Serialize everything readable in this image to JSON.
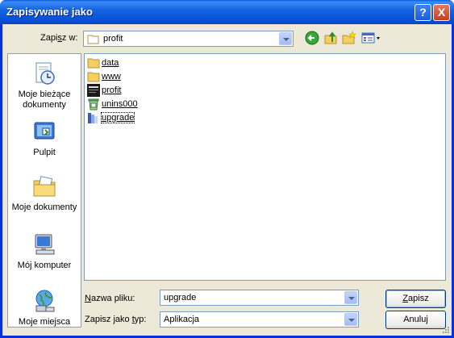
{
  "window": {
    "title": "Zapisywanie jako"
  },
  "titlebar_buttons": {
    "help": "?",
    "close": "X"
  },
  "lookin": {
    "label_pre": "Zapi",
    "label_u": "s",
    "label_post": "z w:",
    "value": "profit"
  },
  "toolbar": {
    "back_icon": "back-arrow-icon",
    "up_icon": "up-folder-icon",
    "newfolder_icon": "new-folder-icon",
    "views_icon": "views-menu-icon"
  },
  "places": [
    {
      "label": "Moje bieżące dokumenty",
      "icon": "recent-documents-icon"
    },
    {
      "label": "Pulpit",
      "icon": "desktop-icon"
    },
    {
      "label": "Moje dokumenty",
      "icon": "my-documents-icon"
    },
    {
      "label": "Mój komputer",
      "icon": "my-computer-icon"
    },
    {
      "label": "Moje miejsca",
      "icon": "network-places-icon"
    }
  ],
  "files": [
    {
      "name": "data",
      "icon": "folder-icon"
    },
    {
      "name": "www",
      "icon": "folder-icon"
    },
    {
      "name": "profit",
      "icon": "app-icon"
    },
    {
      "name": "unins000",
      "icon": "uninstall-icon"
    },
    {
      "name": "upgrade",
      "icon": "installer-icon",
      "selected": true
    }
  ],
  "filename": {
    "label_u": "N",
    "label_rest": "azwa pliku:",
    "value": "upgrade"
  },
  "filetype": {
    "label_pre": "Zapisz jako ",
    "label_u": "t",
    "label_post": "yp:",
    "value": "Aplikacja"
  },
  "buttons": {
    "save_u": "Z",
    "save_rest": "apisz",
    "cancel": "Anuluj"
  },
  "colors": {
    "titlebar": "#0a5bdc",
    "client": "#ece9d8",
    "border": "#7f9db9"
  }
}
